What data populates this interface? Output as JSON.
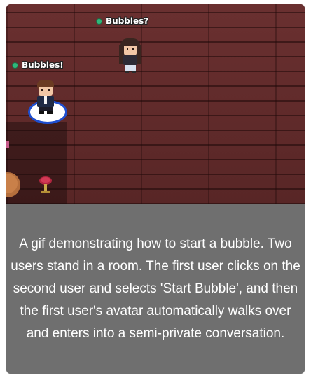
{
  "scene": {
    "user_one_name": "Bubbles!",
    "user_two_name": "Bubbles?",
    "status_color": "#2fb87a",
    "floor_color": "#5a2a2a",
    "selection_ring_color": "#1e4fd0"
  },
  "caption": {
    "text": "A gif demonstrating how to start a bubble. Two users stand in a room. The first user clicks on the second user and selects 'Start Bubble', and then the first user's avatar automatically walks over and enters into a semi-private conversation."
  }
}
